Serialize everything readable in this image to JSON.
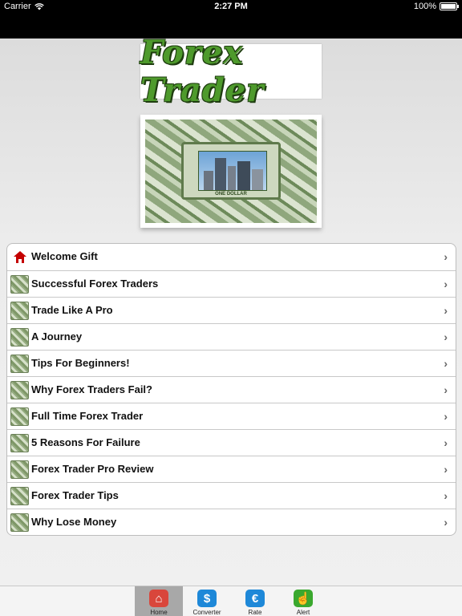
{
  "status_bar": {
    "carrier": "Carrier",
    "time": "2:27 PM",
    "battery": "100%",
    "battery_level": 1.0
  },
  "header": {
    "logo_text": "Forex Trader"
  },
  "banner": {
    "caption": "ONE DOLLAR"
  },
  "menu": {
    "items": [
      {
        "label": "Welcome Gift",
        "icon": "home-icon"
      },
      {
        "label": "Successful Forex Traders",
        "icon": "money-icon"
      },
      {
        "label": "Trade Like A Pro",
        "icon": "money-icon"
      },
      {
        "label": "A Journey",
        "icon": "money-icon"
      },
      {
        "label": "Tips For Beginners!",
        "icon": "money-icon"
      },
      {
        "label": "Why Forex Traders Fail?",
        "icon": "money-icon"
      },
      {
        "label": "Full Time Forex Trader",
        "icon": "money-icon"
      },
      {
        "label": "5 Reasons For Failure",
        "icon": "money-icon"
      },
      {
        "label": "Forex Trader Pro Review",
        "icon": "money-icon"
      },
      {
        "label": "Forex Trader Tips",
        "icon": "money-icon"
      },
      {
        "label": "Why Lose Money",
        "icon": "money-icon"
      }
    ],
    "chevron": "›"
  },
  "tabbar": {
    "tabs": [
      {
        "label": "Home",
        "icon": "home-icon",
        "color": "#d9463b",
        "glyph": "⌂",
        "active": true
      },
      {
        "label": "Converter",
        "icon": "dollar-icon",
        "color": "#1e88d8",
        "glyph": "$",
        "active": false
      },
      {
        "label": "Rate",
        "icon": "euro-icon",
        "color": "#1e88d8",
        "glyph": "€",
        "active": false
      },
      {
        "label": "Alert",
        "icon": "hand-pointer-icon",
        "color": "#3aa82e",
        "glyph": "☝",
        "active": false
      }
    ]
  }
}
